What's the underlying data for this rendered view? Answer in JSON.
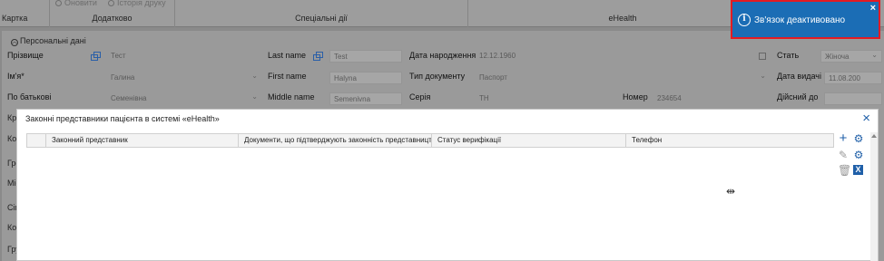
{
  "ribbon": {
    "card": "Картка",
    "additional": "Додатково",
    "special": "Спеціальні дії",
    "ehealth": "eHealth",
    "faded_refresh": "Оновити",
    "faded_history": "Історія друку"
  },
  "notification": {
    "message": "Зв'язок деактивовано",
    "close": "×",
    "info_icon": "i",
    "accent": "#1b6db5",
    "border": "#e31b23"
  },
  "personal": {
    "section_title": "Персональні дані",
    "surname_label": "Прізвище",
    "surname_value": "Тест",
    "name_label": "Ім'я*",
    "name_value": "Галина",
    "patronymic_label": "По батькові",
    "patronymic_value": "Семенівна",
    "lastname_label": "Last name",
    "lastname_value": "Test",
    "firstname_label": "First name",
    "firstname_value": "Halyna",
    "middlename_label": "Middle name",
    "middlename_value": "Semenivna",
    "birth_label": "Дата народження",
    "birth_value": "12.12.1960",
    "doctype_label": "Тип документу",
    "doctype_value": "Паспорт",
    "series_label": "Серія",
    "series_value": "ТН",
    "number_label": "Номер",
    "number_value": "234654",
    "sex_label": "Стать",
    "sex_value": "Жіноча",
    "issue_label": "Дата видачі",
    "issue_value": "11.08.200",
    "valid_label": "Дійсний до"
  },
  "left_labels": [
    "Кра",
    "Кон",
    "Гро",
    "Міс",
    "Сім",
    "Кон",
    "Гру"
  ],
  "modal": {
    "title": "Законні представники пацієнта в системі «eHealth»",
    "close": "×",
    "columns": [
      "Законний представник",
      "Документи, що підтверджують законність представництва",
      "Статус верифікації",
      "Телефон"
    ]
  },
  "icons": [
    "add-icon",
    "settings-icon",
    "edit-icon",
    "settings-alt-icon",
    "delete-icon",
    "export-excel-icon"
  ]
}
